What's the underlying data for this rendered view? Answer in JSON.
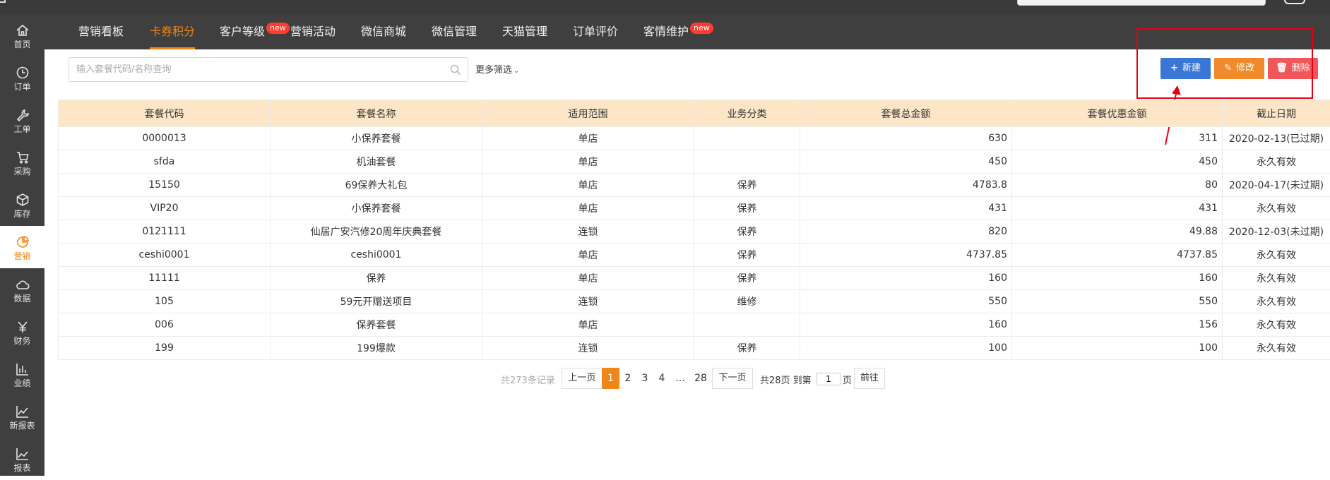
{
  "sidebar": {
    "items": [
      {
        "label": "首页",
        "icon": "home-icon"
      },
      {
        "label": "订单",
        "icon": "clock-icon"
      },
      {
        "label": "工单",
        "icon": "wrench-icon"
      },
      {
        "label": "采购",
        "icon": "cart-icon"
      },
      {
        "label": "库存",
        "icon": "box-icon"
      },
      {
        "label": "营销",
        "icon": "pie-chart-icon",
        "active": true
      },
      {
        "label": "数据",
        "icon": "cloud-icon"
      },
      {
        "label": "财务",
        "icon": "yen-icon"
      },
      {
        "label": "业绩",
        "icon": "bar-chart-icon"
      },
      {
        "label": "新报表",
        "icon": "line-chart-icon"
      },
      {
        "label": "报表",
        "icon": "report-chart-icon"
      }
    ]
  },
  "nav": {
    "items": [
      {
        "label": "营销看板"
      },
      {
        "label": "卡券积分",
        "active": true
      },
      {
        "label": "客户等级",
        "badge": "new"
      },
      {
        "label": "营销活动"
      },
      {
        "label": "微信商城"
      },
      {
        "label": "微信管理"
      },
      {
        "label": "天猫管理"
      },
      {
        "label": "订单评价"
      },
      {
        "label": "客情维护",
        "badge": "new"
      }
    ]
  },
  "search": {
    "placeholder": "输入套餐代码/名称查询",
    "more_filter": "更多筛选"
  },
  "actions": {
    "new": "新建",
    "edit": "修改",
    "delete": "删除"
  },
  "table": {
    "headers": [
      "套餐代码",
      "套餐名称",
      "适用范围",
      "业务分类",
      "套餐总金额",
      "套餐优惠金额",
      "截止日期"
    ],
    "rows": [
      [
        "0000013",
        "小保养套餐",
        "单店",
        "",
        "630",
        "311",
        "2020-02-13(已过期)"
      ],
      [
        "sfda",
        "机油套餐",
        "单店",
        "",
        "450",
        "450",
        "永久有效"
      ],
      [
        "15150",
        "69保养大礼包",
        "单店",
        "保养",
        "4783.8",
        "80",
        "2020-04-17(未过期)"
      ],
      [
        "VIP20",
        "小保养套餐",
        "单店",
        "保养",
        "431",
        "431",
        "永久有效"
      ],
      [
        "0121111",
        "仙居广安汽修20周年庆典套餐",
        "连锁",
        "保养",
        "820",
        "49.88",
        "2020-12-03(未过期)"
      ],
      [
        "ceshi0001",
        "ceshi0001",
        "单店",
        "保养",
        "4737.85",
        "4737.85",
        "永久有效"
      ],
      [
        "11111",
        "保养",
        "单店",
        "保养",
        "160",
        "160",
        "永久有效"
      ],
      [
        "105",
        "59元开赠送项目",
        "连锁",
        "维修",
        "550",
        "550",
        "永久有效"
      ],
      [
        "006",
        "保养套餐",
        "单店",
        "",
        "160",
        "156",
        "永久有效"
      ],
      [
        "199",
        "199爆款",
        "连锁",
        "保养",
        "100",
        "100",
        "永久有效"
      ]
    ]
  },
  "pager": {
    "total": "共273条记录",
    "prev": "上一页",
    "pages": [
      "1",
      "2",
      "3",
      "4",
      "...",
      "28"
    ],
    "current": "1",
    "next": "下一页",
    "summary": "共28页 到第",
    "goto_value": "1",
    "page_unit": "页",
    "go": "前往"
  },
  "colors": {
    "accent": "#f08518",
    "sidebar_bg": "#3f3f3f",
    "header_bg": "#fde6c7",
    "new_btn": "#3a76d5",
    "edit_btn": "#f08a2a",
    "delete_btn": "#f1575a",
    "annotation": "#e60012"
  }
}
